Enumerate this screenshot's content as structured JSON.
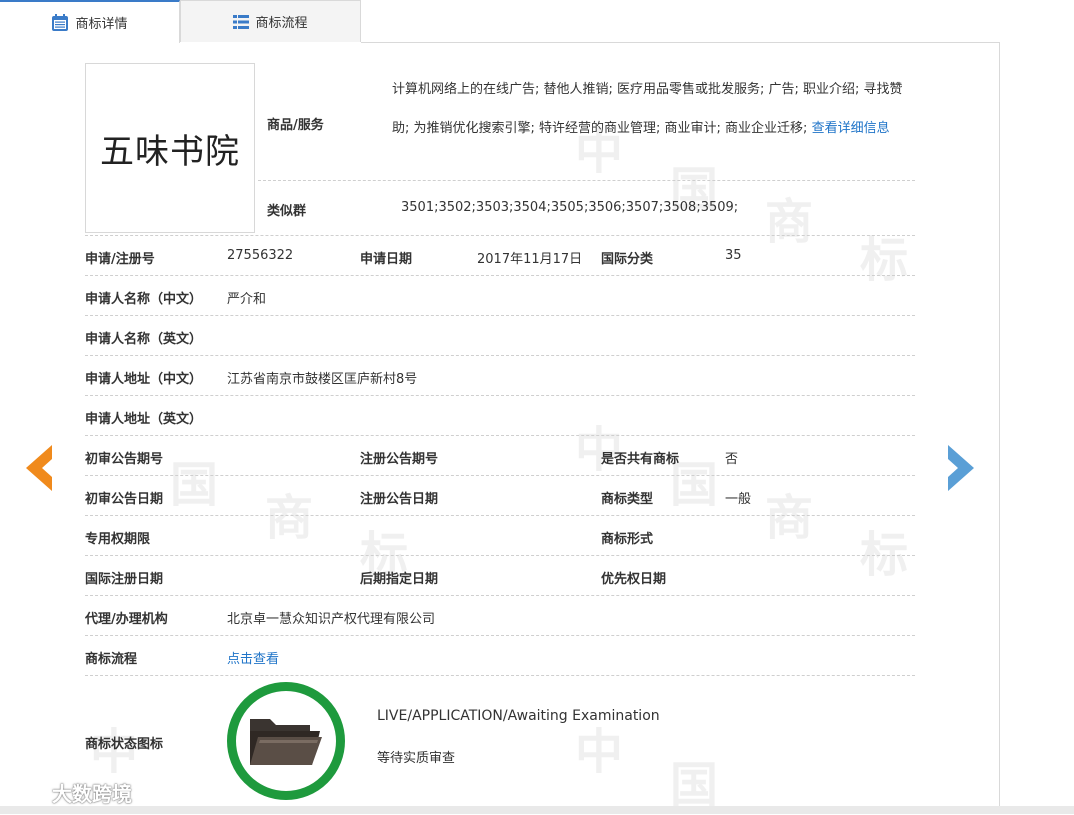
{
  "tabs": {
    "details": "商标详情",
    "process": "商标流程"
  },
  "logo_text": "五味书院",
  "goods_services": {
    "label": "商品/服务",
    "text": "计算机网络上的在线广告; 替他人推销; 医疗用品零售或批发服务; 广告; 职业介绍; 寻找赞助; 为推销优化搜索引擎; 特许经营的商业管理; 商业审计; 商业企业迁移;",
    "more_link": "查看详细信息"
  },
  "similar_group": {
    "label": "类似群",
    "value": "3501;3502;3503;3504;3505;3506;3507;3508;3509;"
  },
  "fields": {
    "reg_no_label": "申请/注册号",
    "reg_no": "27556322",
    "apply_date_label": "申请日期",
    "apply_date": "2017年11月17日",
    "intl_class_label": "国际分类",
    "intl_class": "35",
    "applicant_cn_label": "申请人名称（中文）",
    "applicant_cn": "严介和",
    "applicant_en_label": "申请人名称（英文）",
    "applicant_en": "",
    "address_cn_label": "申请人地址（中文）",
    "address_cn": "江苏省南京市鼓楼区匡庐新村8号",
    "address_en_label": "申请人地址（英文）",
    "address_en": "",
    "prelim_pub_no_label": "初审公告期号",
    "prelim_pub_no": "",
    "reg_pub_no_label": "注册公告期号",
    "reg_pub_no": "",
    "shared_label": "是否共有商标",
    "shared": "否",
    "prelim_pub_date_label": "初审公告日期",
    "prelim_pub_date": "",
    "reg_pub_date_label": "注册公告日期",
    "reg_pub_date": "",
    "tm_type_label": "商标类型",
    "tm_type": "一般",
    "exclusive_period_label": "专用权期限",
    "exclusive_period": "",
    "tm_form_label": "商标形式",
    "tm_form": "",
    "intl_reg_date_label": "国际注册日期",
    "intl_reg_date": "",
    "later_date_label": "后期指定日期",
    "later_date": "",
    "priority_date_label": "优先权日期",
    "priority_date": "",
    "agent_label": "代理/办理机构",
    "agent": "北京卓一慧众知识产权代理有限公司",
    "flow_label": "商标流程",
    "flow_link": "点击查看",
    "status_icon_label": "商标状态图标",
    "status_en": "LIVE/APPLICATION/Awaiting Examination",
    "status_cn": "等待实质审查"
  },
  "watermark": {
    "glyphs": [
      "中",
      "国",
      "商",
      "标"
    ]
  },
  "branding": {
    "name": "大数跨境"
  },
  "colors": {
    "link": "#1f74c8",
    "tab_accent": "#3a7bc8",
    "prev_arrow": "#f08a1c",
    "next_arrow": "#5a9fd6",
    "status_ring": "#1e9a3d"
  },
  "icons": {
    "details_tab": "calendar-icon",
    "process_tab": "list-icon",
    "prev": "chevron-left-icon",
    "next": "chevron-right-icon",
    "status": "folder-icon"
  }
}
